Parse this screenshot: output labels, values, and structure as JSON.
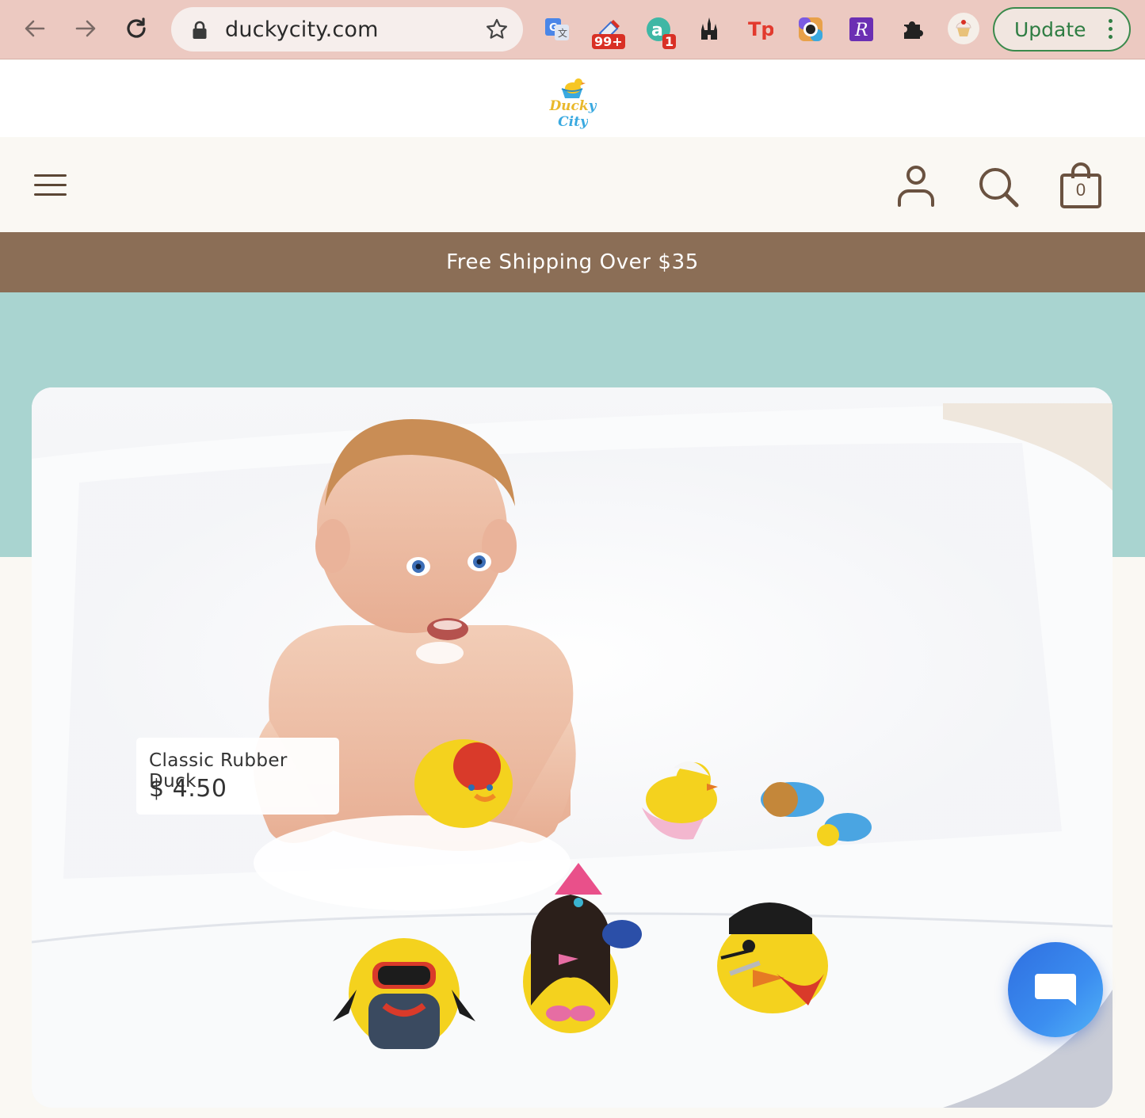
{
  "browser": {
    "url": "duckycity.com",
    "extensions": [
      {
        "name": "google-translate-icon"
      },
      {
        "name": "eraser-extension-icon",
        "badge": "99+"
      },
      {
        "name": "a-extension-icon",
        "badge": "1"
      },
      {
        "name": "castle-extension-icon"
      },
      {
        "name": "tp-extension-icon"
      },
      {
        "name": "camera-extension-icon"
      },
      {
        "name": "r-extension-icon"
      },
      {
        "name": "puzzle-extensions-icon"
      },
      {
        "name": "profile-cupcake-icon"
      }
    ],
    "update_label": "Update"
  },
  "site": {
    "logo_text": "Ducky City",
    "cart_count": "0",
    "announcement": "Free Shipping Over $35"
  },
  "hero": {
    "product_name": "Classic Rubber Duck",
    "product_price": "$ 4.50"
  },
  "colors": {
    "chrome_bg": "#ecc9c1",
    "announce_bg": "#8b6e56",
    "teal": "#a9d4d0",
    "cream": "#faf8f3",
    "icon_brown": "#5b4634",
    "chat_blue": "#2f6fe0"
  }
}
